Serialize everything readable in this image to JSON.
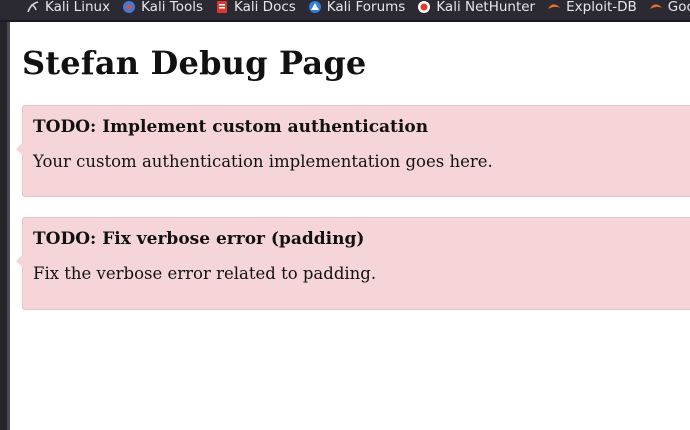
{
  "bookmarks": [
    {
      "label": "Kali Linux",
      "icon": "kali-dragon-icon"
    },
    {
      "label": "Kali Tools",
      "icon": "kali-tools-icon"
    },
    {
      "label": "Kali Docs",
      "icon": "kali-docs-icon"
    },
    {
      "label": "Kali Forums",
      "icon": "kali-forums-icon"
    },
    {
      "label": "Kali NetHunter",
      "icon": "kali-nethunter-icon"
    },
    {
      "label": "Exploit-DB",
      "icon": "exploit-db-icon"
    },
    {
      "label": "Goo",
      "icon": "google-hacking-db-icon"
    }
  ],
  "page": {
    "title": "Stefan Debug Page"
  },
  "todos": [
    {
      "heading": "TODO: Implement custom authentication",
      "body": "Your custom authentication implementation goes here."
    },
    {
      "heading": "TODO: Fix verbose error (padding)",
      "body": "Fix the verbose error related to padding."
    }
  ],
  "colors": {
    "note_background": "#f6d5d8",
    "note_border": "#e7c2c6",
    "toolbar_background": "#2b2a33"
  }
}
